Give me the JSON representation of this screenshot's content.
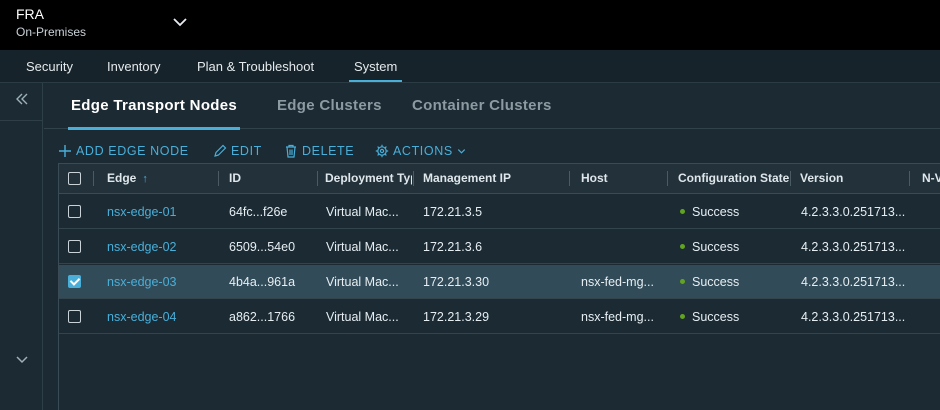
{
  "site": {
    "name": "FRA",
    "type": "On-Premises"
  },
  "nav": {
    "tabs": [
      "Security",
      "Inventory",
      "Plan & Troubleshoot",
      "System"
    ],
    "active": "System"
  },
  "subtabs": {
    "items": [
      "Edge Transport Nodes",
      "Edge Clusters",
      "Container Clusters"
    ],
    "active": "Edge Transport Nodes"
  },
  "toolbar": {
    "add": "ADD EDGE NODE",
    "edit": "EDIT",
    "delete": "DELETE",
    "actions": "ACTIONS"
  },
  "grid": {
    "columns": [
      "Edge",
      "ID",
      "Deployment Typ",
      "Management IP",
      "Host",
      "Configuration State",
      "Version",
      "N-V"
    ],
    "sort_column": "Edge",
    "rows": [
      {
        "selected": false,
        "edge": "nsx-edge-01",
        "id": "64fc...f26e",
        "deployment": "Virtual Mac...",
        "ip": "172.21.3.5",
        "host": "",
        "state": "Success",
        "version": "4.2.3.3.0.251713..."
      },
      {
        "selected": false,
        "edge": "nsx-edge-02",
        "id": "6509...54e0",
        "deployment": "Virtual Mac...",
        "ip": "172.21.3.6",
        "host": "",
        "state": "Success",
        "version": "4.2.3.3.0.251713..."
      },
      {
        "selected": true,
        "edge": "nsx-edge-03",
        "id": "4b4a...961a",
        "deployment": "Virtual Mac...",
        "ip": "172.21.3.30",
        "host": "nsx-fed-mg...",
        "state": "Success",
        "version": "4.2.3.3.0.251713..."
      },
      {
        "selected": false,
        "edge": "nsx-edge-04",
        "id": "a862...1766",
        "deployment": "Virtual Mac...",
        "ip": "172.21.3.29",
        "host": "nsx-fed-mg...",
        "state": "Success",
        "version": "4.2.3.3.0.251713..."
      }
    ]
  },
  "colors": {
    "accent": "#49afd9",
    "success": "#62a420",
    "background": "#1b2a33"
  }
}
